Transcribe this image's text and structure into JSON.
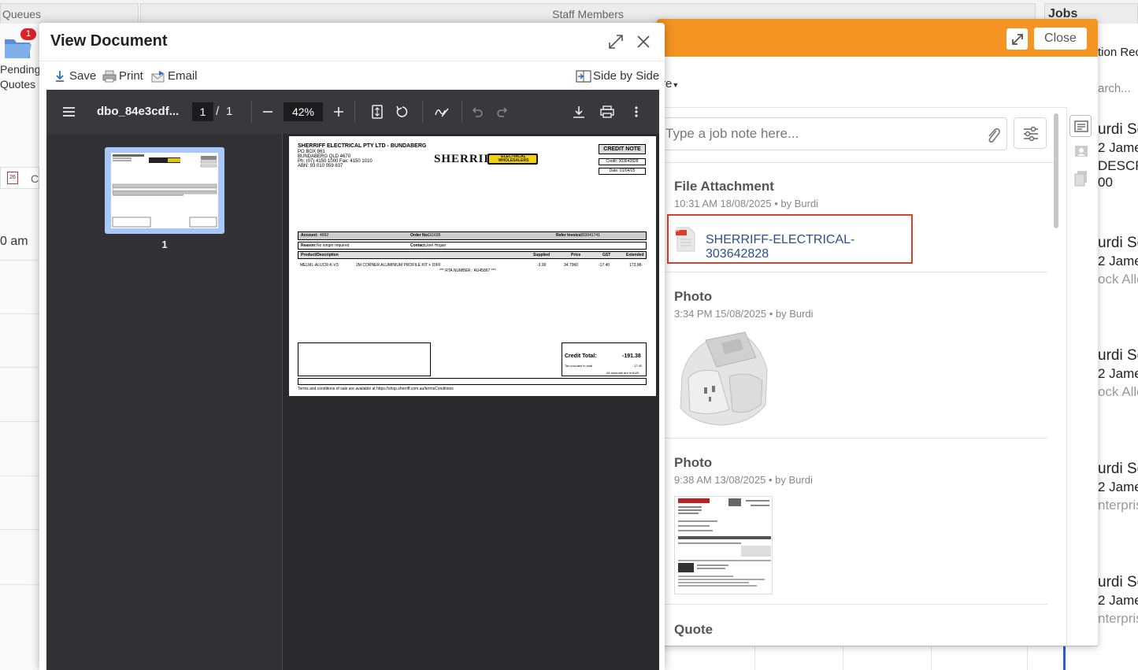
{
  "background": {
    "tabs": {
      "queues": "Queues",
      "staff_members": "Staff Members",
      "jobs": "Jobs"
    },
    "pending_quotes": {
      "label_line1": "Pending",
      "label_line2": "Quotes",
      "badge": "1"
    },
    "calendar_tab": {
      "day": "26",
      "label": "Ca"
    },
    "time_label": "0 am",
    "right_column": [
      {
        "title": "tion Rec",
        "sub": ""
      },
      {
        "title": "arch...",
        "sub": ""
      },
      {
        "title": "urdi Sc",
        "line2": "2 James",
        "line3": "DESCR",
        "line4": "00"
      },
      {
        "title": "urdi Sc",
        "line2": "2 James",
        "line3": "ock Allo"
      },
      {
        "title": "urdi Sc",
        "line2": "2 James",
        "line3": "ock Allo"
      },
      {
        "title": "urdi Sc",
        "line2": "2 James",
        "line3": "nterpris"
      },
      {
        "title": "urdi Sc",
        "line2": "2 James",
        "line3": "nterpris"
      }
    ]
  },
  "job_panel": {
    "close_label": "Close",
    "more_label": "re",
    "note_placeholder": "Type a job note here...",
    "entries": [
      {
        "title": "File Attachment",
        "meta": "10:31 AM 18/08/2025 •  by Burdi",
        "file": "SHERRIFF-ELECTRICAL-303642828",
        "file_badge": "PDF"
      },
      {
        "title": "Photo",
        "meta": "3:34 PM 15/08/2025 •  by Burdi"
      },
      {
        "title": "Photo",
        "meta": "9:38 AM 13/08/2025 •  by Burdi"
      },
      {
        "title": "Quote",
        "meta": ""
      }
    ]
  },
  "view_document": {
    "title": "View Document",
    "toolbar": {
      "save": "Save",
      "print": "Print",
      "email": "Email",
      "side_by_side": "Side by Side"
    },
    "pdf": {
      "filename": "dbo_84e3cdf...",
      "page_current": "1",
      "page_sep": "/",
      "page_total": "1",
      "zoom": "42%",
      "thumb_label": "1"
    },
    "document": {
      "company": "SHERRIFF ELECTRICAL PTY LTD - BUNDABERG",
      "addr1": "PO BOX 861",
      "addr2": "BUNDABERG QLD 4670",
      "phone": "Ph: (07) 4150 1000   Fax: 4150 1010",
      "abn": "ABN: 93 010 059 837",
      "logo_main": "SHERRIFF",
      "logo_sub1": "ELECTRICAL",
      "logo_sub2": "WHOLESALERS",
      "doc_type": "CREDIT NOTE",
      "credit_no": "Credit: 303642828",
      "date": "Date: 01/04/25",
      "account_label": "Account:",
      "account": "4992",
      "order_label": "Order No:",
      "order": "GI1695",
      "refer_label": "Refer Invoice:",
      "refer": "303641741",
      "reason_label": "Reason:",
      "reason": "No longer required",
      "contact_label": "Contact:",
      "contact": "Joel Hogan",
      "headers": {
        "product": "Product/Description",
        "supplied": "Supplied",
        "price": "Price",
        "gst": "GST",
        "extended": "Extended"
      },
      "line": {
        "code": "MELML-ALUCR-K-V3",
        "desc": "2M CORNER ALUMINIUM PROFILE KIT + DIFF",
        "supplied": "-3.00",
        "price": "34.7960",
        "gst": "-17.40",
        "extended": "173.98-"
      },
      "rta": "***  RTA NUMBER : AU45867  ***",
      "credit_total_label": "Credit Total:",
      "credit_total": "-191.38",
      "tax_label": "Tax included in total",
      "tax": "-17.40",
      "currency_note": "All amounts are in AUD",
      "terms": "Terms and conditions of sale are available at https://shop.sherriff.com.au/termsConditions"
    }
  },
  "colors": {
    "accent": "#f39423",
    "link": "#2d4f8f",
    "highlight": "#d9402b",
    "pdf_bg": "#2a2a2e"
  }
}
